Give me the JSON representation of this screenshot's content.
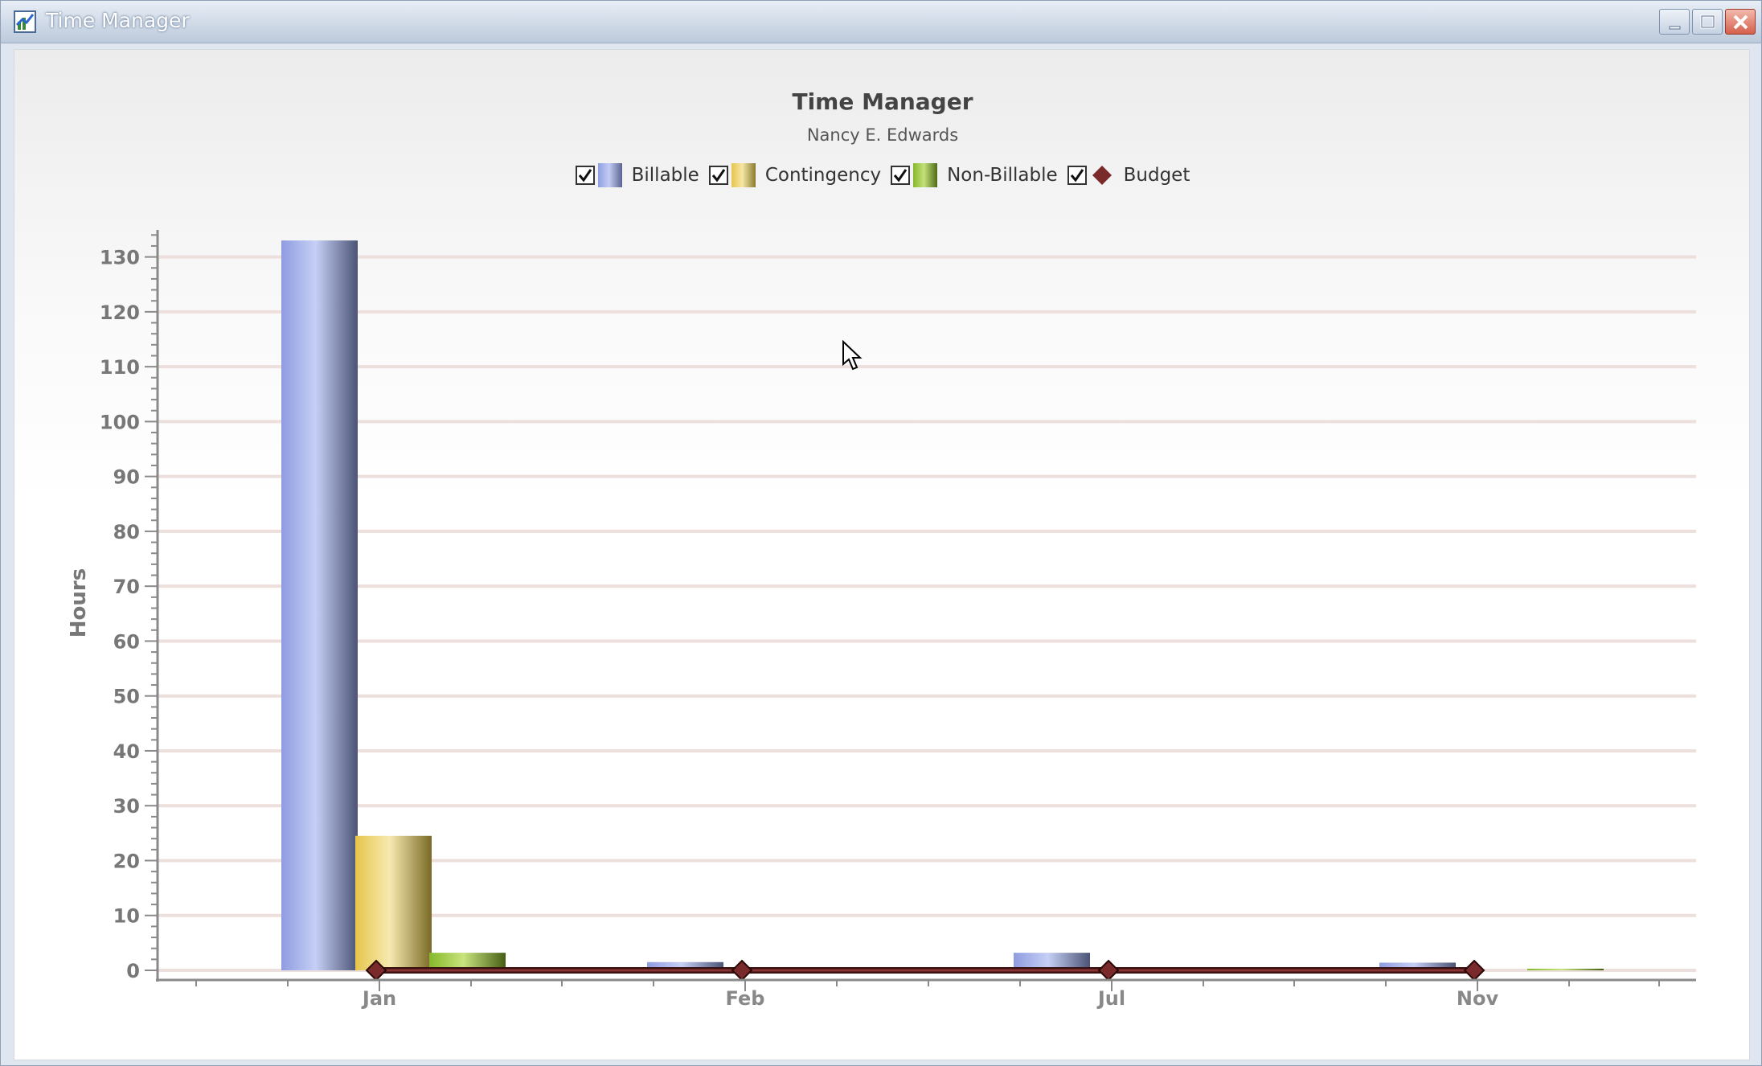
{
  "window": {
    "title": "Time Manager"
  },
  "chart_data": {
    "type": "bar",
    "title": "Time Manager",
    "subtitle": "Nancy E. Edwards",
    "ylabel": "Hours",
    "xlabel": "",
    "ylim": [
      0,
      135
    ],
    "yticks": [
      0,
      10,
      20,
      30,
      40,
      50,
      60,
      70,
      80,
      90,
      100,
      110,
      120,
      130
    ],
    "categories": [
      "Jan",
      "Feb",
      "Jul",
      "Nov"
    ],
    "series": [
      {
        "name": "Billable",
        "kind": "bar",
        "color": "#9aa8e6",
        "values": [
          133,
          1.5,
          3.2,
          1.4
        ]
      },
      {
        "name": "Contingency",
        "kind": "bar",
        "color": "#e8cd5a",
        "values": [
          24.5,
          0,
          0,
          0
        ]
      },
      {
        "name": "Non-Billable",
        "kind": "bar",
        "color": "#8fbf2e",
        "values": [
          3.2,
          0,
          0,
          0.3
        ]
      },
      {
        "name": "Budget",
        "kind": "line",
        "color": "#7a2a2a",
        "values": [
          0,
          0,
          0,
          0
        ]
      }
    ],
    "legend_position": "top-center",
    "grid": true
  }
}
